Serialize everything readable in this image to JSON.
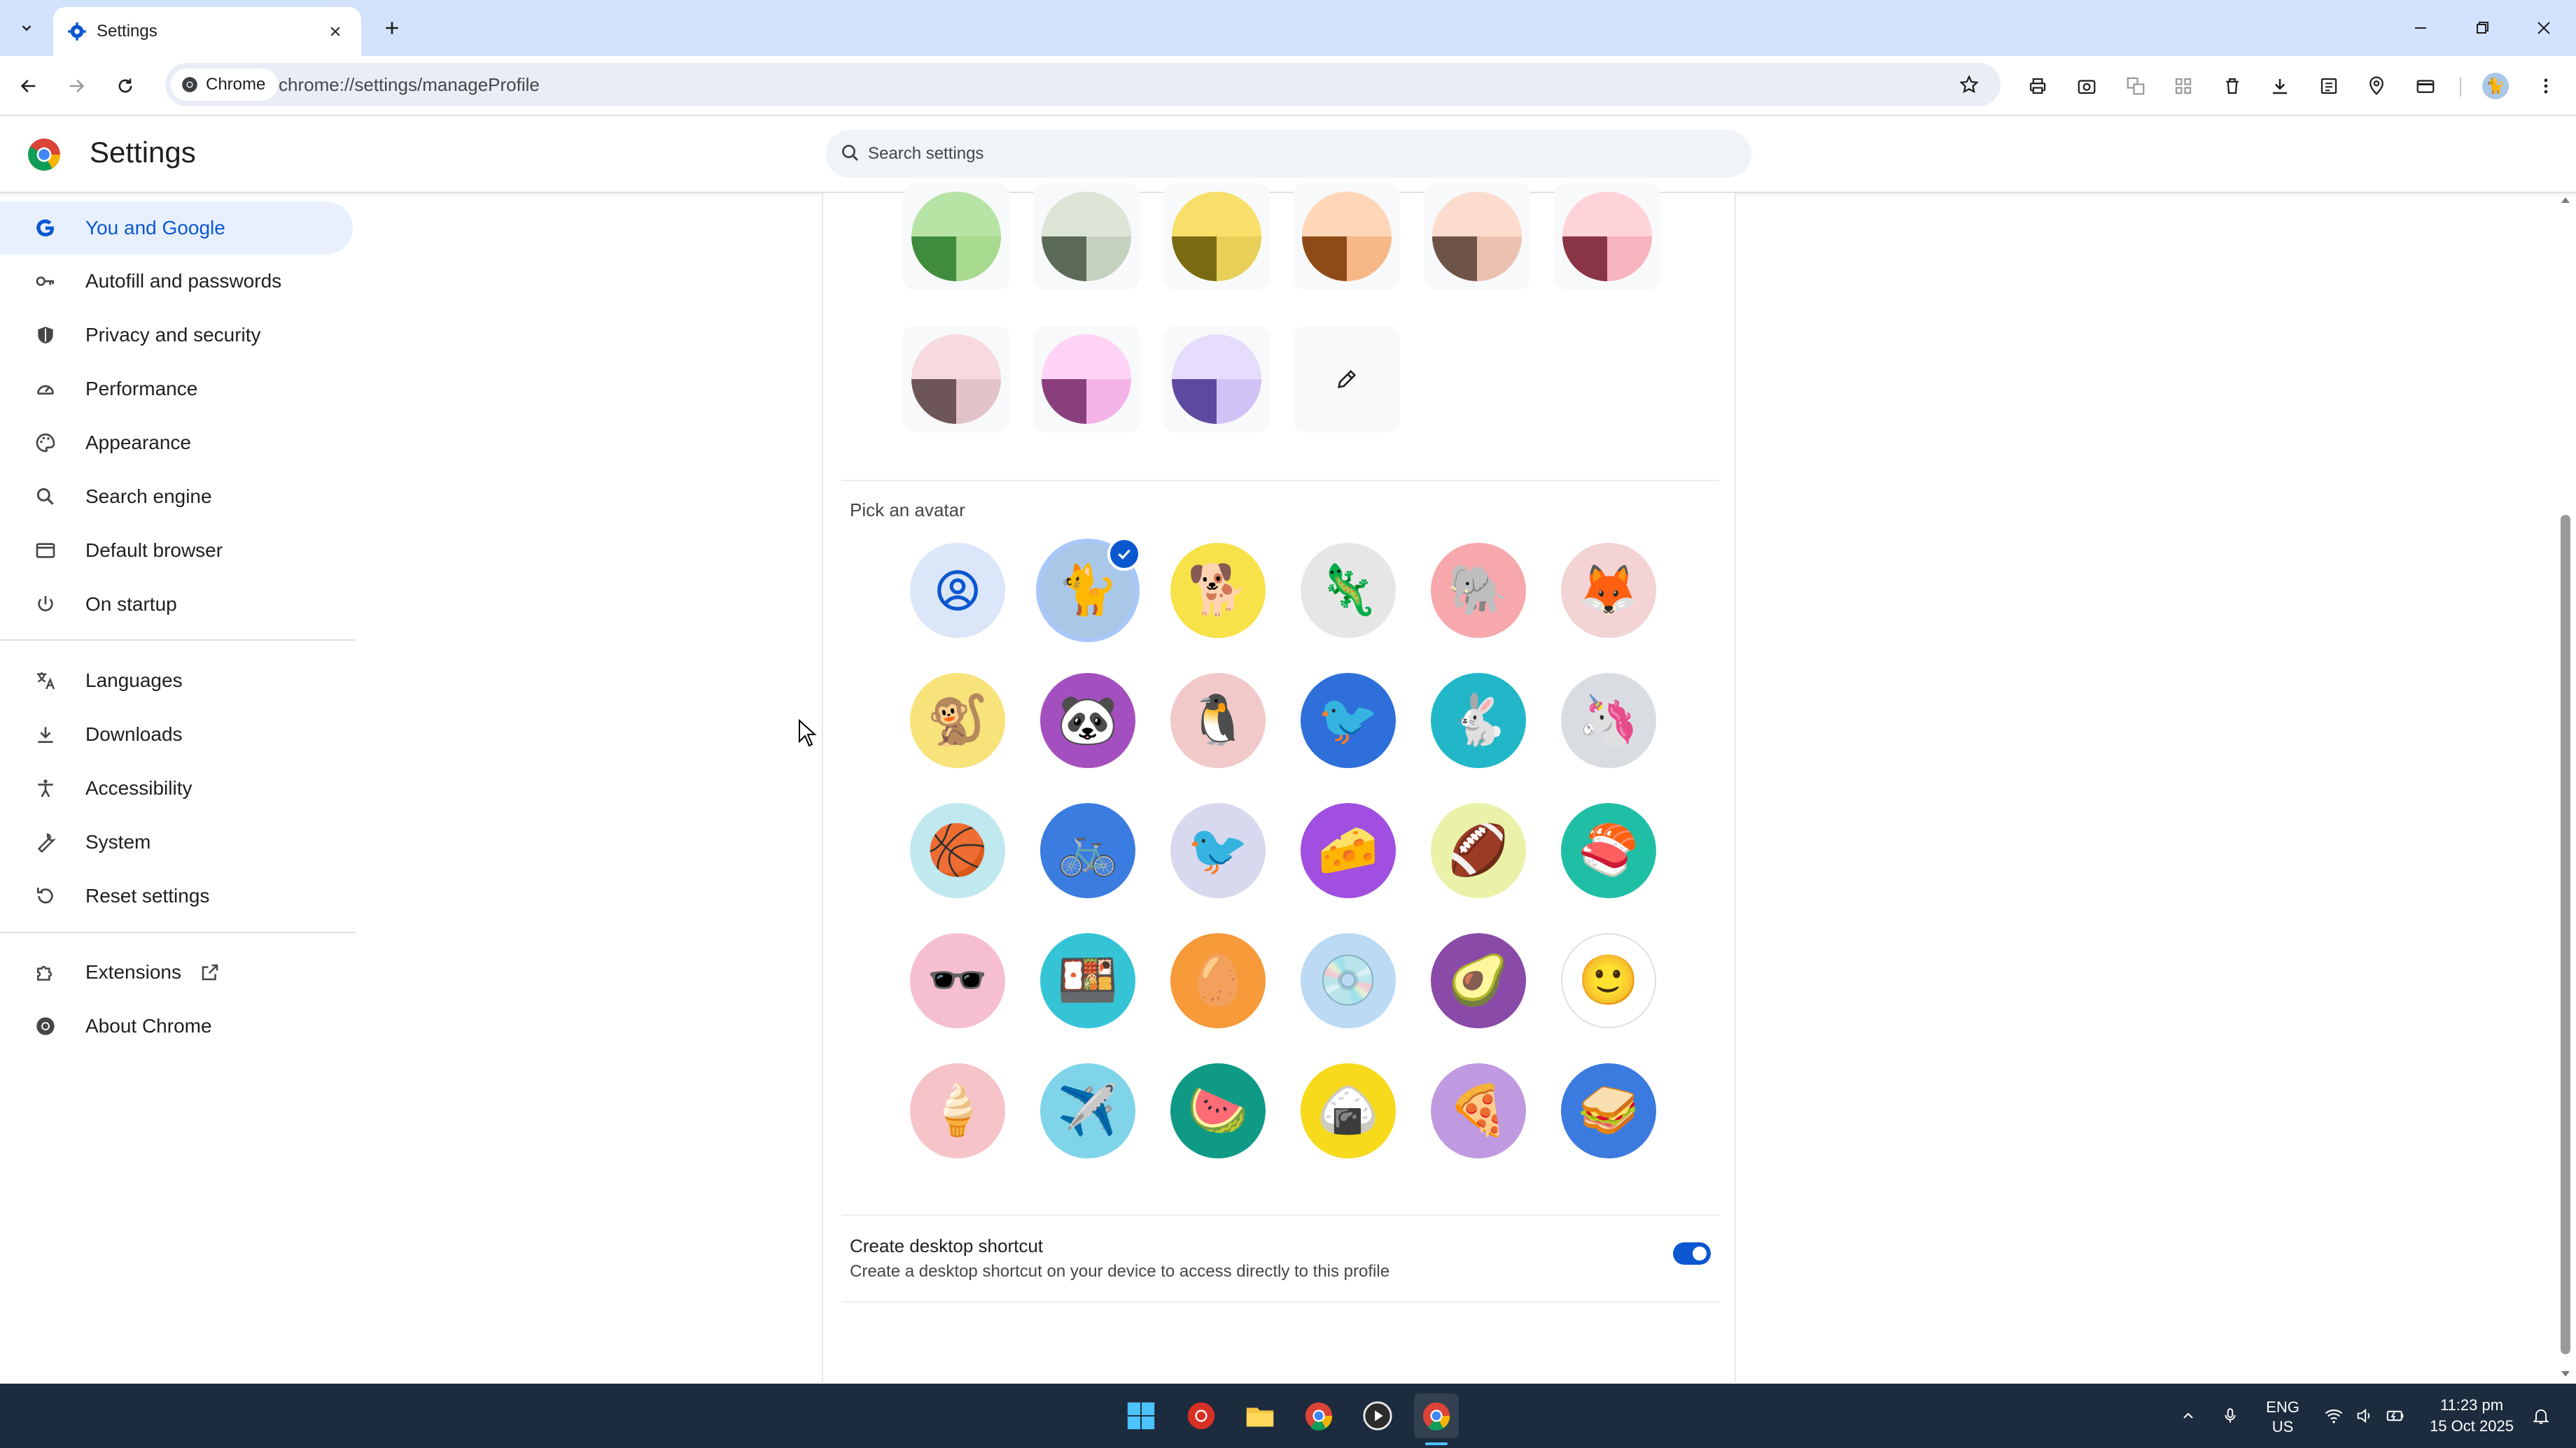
{
  "tab": {
    "title": "Settings"
  },
  "omnibox": {
    "chip_label": "Chrome",
    "url": "chrome://settings/manageProfile"
  },
  "header": {
    "title": "Settings",
    "search_placeholder": "Search settings"
  },
  "sidebar": {
    "items": [
      {
        "label": "You and Google",
        "icon": "google-g-icon",
        "active": true
      },
      {
        "label": "Autofill and passwords",
        "icon": "key-icon"
      },
      {
        "label": "Privacy and security",
        "icon": "shield-icon"
      },
      {
        "label": "Performance",
        "icon": "speedometer-icon"
      },
      {
        "label": "Appearance",
        "icon": "palette-icon"
      },
      {
        "label": "Search engine",
        "icon": "search-icon"
      },
      {
        "label": "Default browser",
        "icon": "browser-window-icon"
      },
      {
        "label": "On startup",
        "icon": "power-icon"
      },
      {
        "label": "Languages",
        "icon": "translate-icon"
      },
      {
        "label": "Downloads",
        "icon": "download-icon"
      },
      {
        "label": "Accessibility",
        "icon": "accessibility-icon"
      },
      {
        "label": "System",
        "icon": "wrench-icon"
      },
      {
        "label": "Reset settings",
        "icon": "reset-icon"
      },
      {
        "label": "Extensions",
        "icon": "puzzle-icon"
      },
      {
        "label": "About Chrome",
        "icon": "chrome-icon"
      }
    ]
  },
  "theme_colors": [
    {
      "name": "green",
      "top": "#b7e4a5",
      "left": "#3f8c3c",
      "right": "#a7d98f"
    },
    {
      "name": "sage",
      "top": "#dde5d7",
      "left": "#5b6b58",
      "right": "#c4d1bf"
    },
    {
      "name": "yellow",
      "top": "#f8df6a",
      "left": "#7a6b12",
      "right": "#e8cf57"
    },
    {
      "name": "apricot",
      "top": "#ffd6b8",
      "left": "#8f4b17",
      "right": "#f7b887"
    },
    {
      "name": "peach",
      "top": "#fbdccd",
      "left": "#6e5347",
      "right": "#ebc2b0"
    },
    {
      "name": "pink",
      "top": "#ffd3d9",
      "left": "#8a3545",
      "right": "#f7b3be"
    },
    {
      "name": "rose",
      "top": "#f6dadd",
      "left": "#6e5558",
      "right": "#e2c3c7"
    },
    {
      "name": "magenta",
      "top": "#ffd3f5",
      "left": "#8a3f7d",
      "right": "#f3b3e6"
    },
    {
      "name": "lavender",
      "top": "#e6dcfb",
      "left": "#5d4aa0",
      "right": "#d1c2f6"
    }
  ],
  "custom_color_label": "Custom color",
  "avatar_section": {
    "title": "Pick an avatar",
    "avatars": [
      {
        "name": "generic-person",
        "emoji": "",
        "bg": "#dbe7f8",
        "selected": false
      },
      {
        "name": "origami-cat",
        "emoji": "🐈",
        "bg": "#a9c8e8",
        "selected": true
      },
      {
        "name": "origami-fox-corgi",
        "emoji": "🐕",
        "bg": "#f7e24a"
      },
      {
        "name": "origami-dragon",
        "emoji": "🦎",
        "bg": "#e6e6e6"
      },
      {
        "name": "origami-elephant",
        "emoji": "🐘",
        "bg": "#f6a8ad"
      },
      {
        "name": "origami-fox",
        "emoji": "🦊",
        "bg": "#f3d3d3"
      },
      {
        "name": "origami-monkey",
        "emoji": "🐒",
        "bg": "#f8e27a"
      },
      {
        "name": "origami-panda",
        "emoji": "🐼",
        "bg": "#a44fbf"
      },
      {
        "name": "origami-penguin",
        "emoji": "🐧",
        "bg": "#f2c9c9"
      },
      {
        "name": "origami-bird",
        "emoji": "🐦",
        "bg": "#2e6fd9"
      },
      {
        "name": "origami-rabbit",
        "emoji": "🐇",
        "bg": "#21b7c9"
      },
      {
        "name": "origami-unicorn",
        "emoji": "🦄",
        "bg": "#d9dde2"
      },
      {
        "name": "basketball",
        "emoji": "🏀",
        "bg": "#bfe8ef"
      },
      {
        "name": "bicycle",
        "emoji": "🚲",
        "bg": "#3a7ce0"
      },
      {
        "name": "red-bird",
        "emoji": "🐦",
        "bg": "#d8d8ee"
      },
      {
        "name": "cheese",
        "emoji": "🧀",
        "bg": "#a04fe0"
      },
      {
        "name": "football",
        "emoji": "🏈",
        "bg": "#e9f2a8"
      },
      {
        "name": "sushi-plate",
        "emoji": "🍣",
        "bg": "#1fbfa6"
      },
      {
        "name": "sunglasses",
        "emoji": "🕶️",
        "bg": "#f6bfd0"
      },
      {
        "name": "sushi",
        "emoji": "🍱",
        "bg": "#35c4d6"
      },
      {
        "name": "tamagotchi",
        "emoji": "🥚",
        "bg": "#f69a3a"
      },
      {
        "name": "vinyl-record",
        "emoji": "💿",
        "bg": "#bcdaf3"
      },
      {
        "name": "avocado",
        "emoji": "🥑",
        "bg": "#8a4aa8"
      },
      {
        "name": "smiley",
        "emoji": "🙂",
        "bg": "#ffffff"
      },
      {
        "name": "ice-cream",
        "emoji": "🍦",
        "bg": "#f6c4c8"
      },
      {
        "name": "paper-plane",
        "emoji": "✈️",
        "bg": "#7fd4ea"
      },
      {
        "name": "watermelon",
        "emoji": "🍉",
        "bg": "#0f9a86"
      },
      {
        "name": "onigiri",
        "emoji": "🍙",
        "bg": "#f7da1c"
      },
      {
        "name": "pizza",
        "emoji": "🍕",
        "bg": "#c09ae0"
      },
      {
        "name": "sandwich",
        "emoji": "🥪",
        "bg": "#3b7be0"
      }
    ]
  },
  "shortcut": {
    "title": "Create desktop shortcut",
    "description": "Create a desktop shortcut on your device to access directly to this profile",
    "enabled": true
  },
  "taskbar": {
    "lang_top": "ENG",
    "lang_bottom": "US",
    "time": "11:23 pm",
    "date": "15 Oct 2025"
  },
  "colors": {
    "accent": "#0b57d0",
    "active_nav_bg": "#e8f0fe",
    "tabstrip": "#d3e3fd",
    "taskbar": "#1c2b3e"
  }
}
